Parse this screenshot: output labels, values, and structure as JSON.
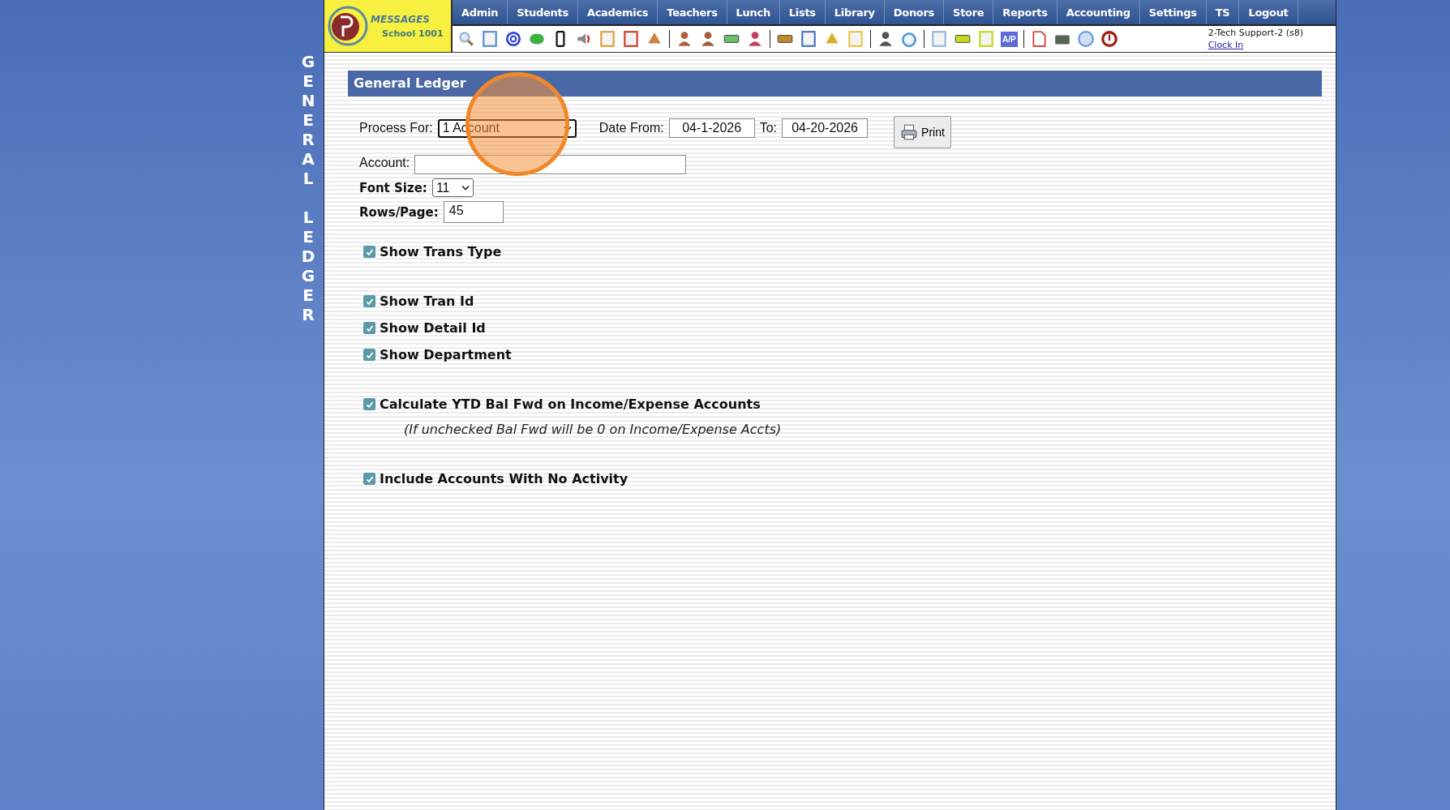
{
  "side_title": "GENERAL LEDGER",
  "logo": {
    "brand": "MESSAGES",
    "school": "School 1001"
  },
  "nav": [
    {
      "label": "Admin"
    },
    {
      "label": "Students"
    },
    {
      "label": "Academics"
    },
    {
      "label": "Teachers"
    },
    {
      "label": "Lunch"
    },
    {
      "label": "Lists"
    },
    {
      "label": "Library"
    },
    {
      "label": "Donors"
    },
    {
      "label": "Store"
    },
    {
      "label": "Reports"
    },
    {
      "label": "Accounting"
    },
    {
      "label": "Settings"
    },
    {
      "label": "TS"
    },
    {
      "label": "Logout"
    }
  ],
  "toolbar": {
    "ap_label": "A/P"
  },
  "user": {
    "name": "2-Tech Support-2 (s8)",
    "link": "Clock In"
  },
  "panel": {
    "title": "General Ledger",
    "process_for": {
      "label": "Process For:",
      "value": "1 Account"
    },
    "date_from": {
      "label": "Date From:",
      "value": "04-1-2026"
    },
    "date_to": {
      "label": "To:",
      "value": "04-20-2026"
    },
    "print": "Print",
    "account": {
      "label": "Account:"
    },
    "font_size": {
      "label": "Font Size:",
      "value": "11"
    },
    "rows_page": {
      "label": "Rows/Page:",
      "value": "45"
    },
    "option_groups": [
      [
        {
          "label": "Show Trans Type",
          "checked": true
        }
      ],
      [
        {
          "label": "Show Tran Id",
          "checked": true
        },
        {
          "label": "Show Detail Id",
          "checked": true
        },
        {
          "label": "Show Department",
          "checked": true
        }
      ],
      [
        {
          "label": "Calculate YTD Bal Fwd on Income/Expense Accounts",
          "checked": true,
          "note": "(If unchecked Bal Fwd will be 0 on Income/Expense Accts)"
        }
      ],
      [
        {
          "label": "Include Accounts With No Activity",
          "checked": true
        }
      ]
    ]
  }
}
